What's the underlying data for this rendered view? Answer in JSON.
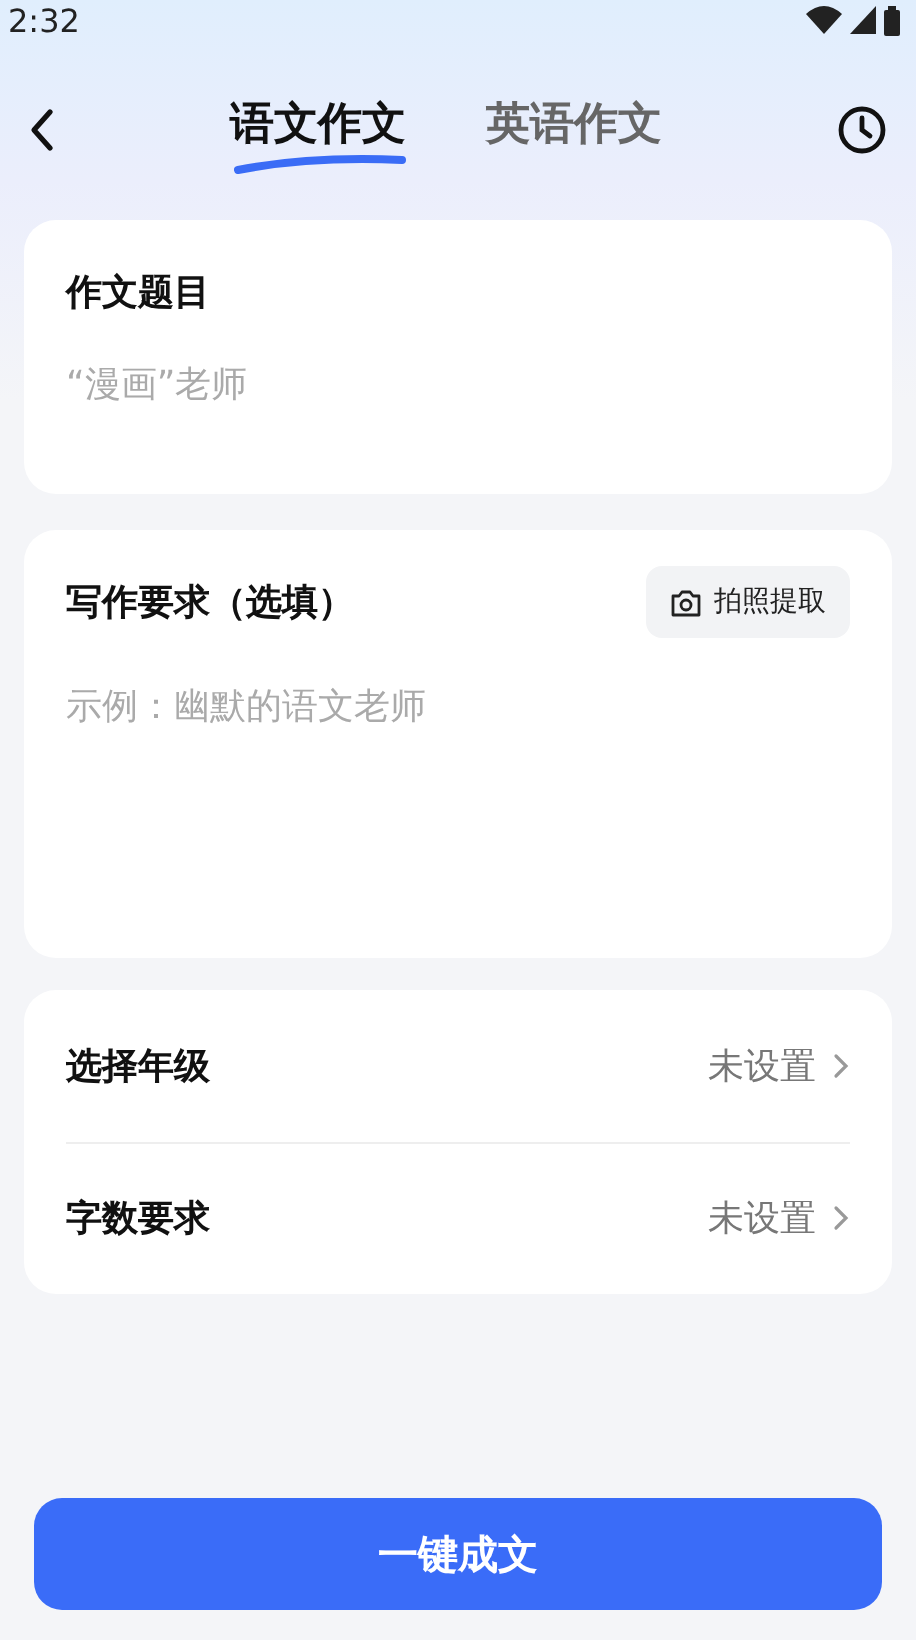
{
  "status_bar": {
    "time": "2:32"
  },
  "tabs": [
    {
      "label": "语文作文",
      "selected": true
    },
    {
      "label": "英语作文",
      "selected": false
    }
  ],
  "topic": {
    "title": "作文题目",
    "placeholder": "“漫画”老师"
  },
  "requirements": {
    "title": "写作要求（选填）",
    "photo_button": "拍照提取",
    "placeholder": "示例：幽默的语文老师"
  },
  "settings": [
    {
      "label": "选择年级",
      "value": "未设置"
    },
    {
      "label": "字数要求",
      "value": "未设置"
    }
  ],
  "submit_button": "一键成文"
}
